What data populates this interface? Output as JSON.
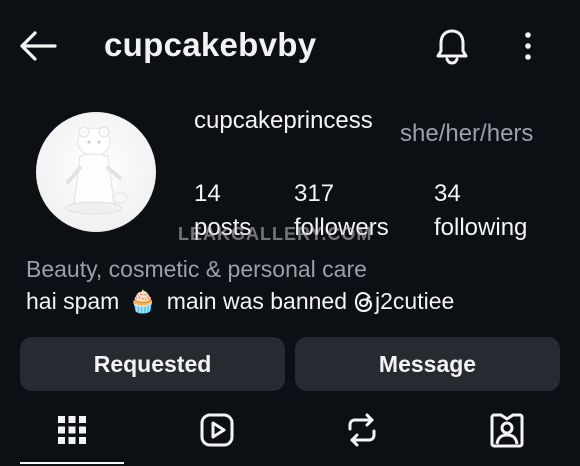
{
  "header": {
    "title": "cupcakebvby",
    "back_icon": "arrow-left-icon",
    "bell_icon": "bell-icon",
    "more_icon": "more-vertical-icon"
  },
  "profile": {
    "avatar_icon": "avatar-figurine",
    "username": "cupcakeprincess",
    "pronouns": "she/her/hers",
    "stats": {
      "posts": {
        "count": "14",
        "label": "posts"
      },
      "followers": {
        "count": "317",
        "label": "followers"
      },
      "following": {
        "count": "34",
        "label": "following"
      }
    },
    "category": "Beauty, cosmetic & personal care",
    "bio": {
      "text_before": "hai spam",
      "emoji": "🧁",
      "text_after": "main was banned",
      "threads_handle": "j2cutiee"
    },
    "watermark": "LEAKGALLERY.COM"
  },
  "actions": {
    "requested_label": "Requested",
    "message_label": "Message"
  },
  "tabs": [
    {
      "icon": "grid-icon"
    },
    {
      "icon": "reels-icon"
    },
    {
      "icon": "reposts-icon"
    },
    {
      "icon": "tagged-icon"
    }
  ],
  "colors": {
    "background": "#0c0f14",
    "button_bg": "#262a31",
    "muted_text": "#9aa0a6",
    "text": "#f4f4f4"
  }
}
